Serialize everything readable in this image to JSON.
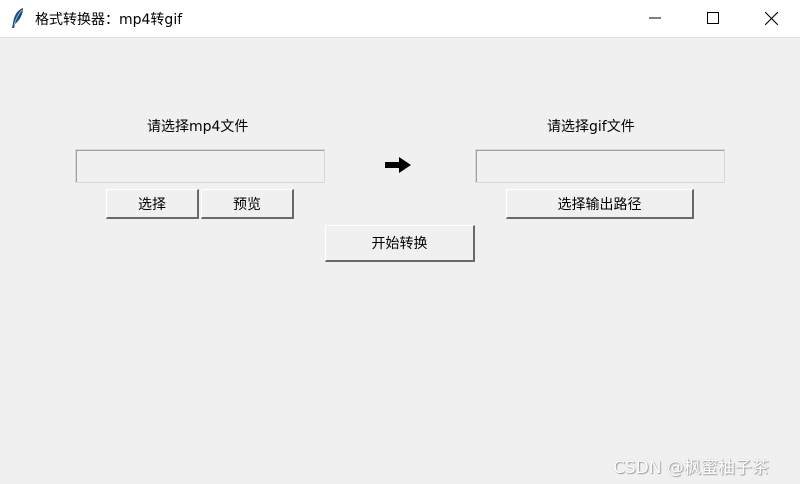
{
  "window": {
    "title": "格式转换器：mp4转gif",
    "controls": {
      "minimize_icon": "minimize-icon",
      "maximize_icon": "maximize-icon",
      "close_icon": "close-icon"
    }
  },
  "source": {
    "label": "请选择mp4文件",
    "path_value": "",
    "select_button": "选择",
    "preview_button": "预览"
  },
  "arrow_icon": "right-arrow-icon",
  "target": {
    "label": "请选择gif文件",
    "path_value": "",
    "output_button": "选择输出路径"
  },
  "start_button": "开始转换",
  "watermark": "CSDN @枫蜜柚子茶"
}
